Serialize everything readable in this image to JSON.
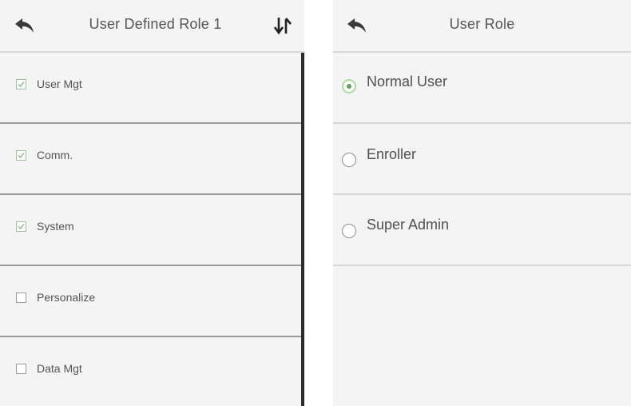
{
  "left_screen": {
    "title": "User Defined Role 1",
    "back_icon": "back-arrow",
    "sort_icon": "sort-arrows",
    "items": [
      {
        "label": "User Mgt",
        "checked": true
      },
      {
        "label": "Comm.",
        "checked": true
      },
      {
        "label": "System",
        "checked": true
      },
      {
        "label": "Personalize",
        "checked": false
      },
      {
        "label": "Data Mgt",
        "checked": false
      }
    ]
  },
  "right_screen": {
    "title": "User Role",
    "back_icon": "back-arrow",
    "options": [
      {
        "label": "Normal User",
        "selected": true
      },
      {
        "label": "Enroller",
        "selected": false
      },
      {
        "label": "Super Admin",
        "selected": false
      }
    ]
  },
  "colors": {
    "background": "#f4f4f4",
    "selected_radio_ring": "#a6dd9c",
    "selected_radio_dot": "#6a9d63",
    "checkbox_check": "#8fb78f"
  }
}
